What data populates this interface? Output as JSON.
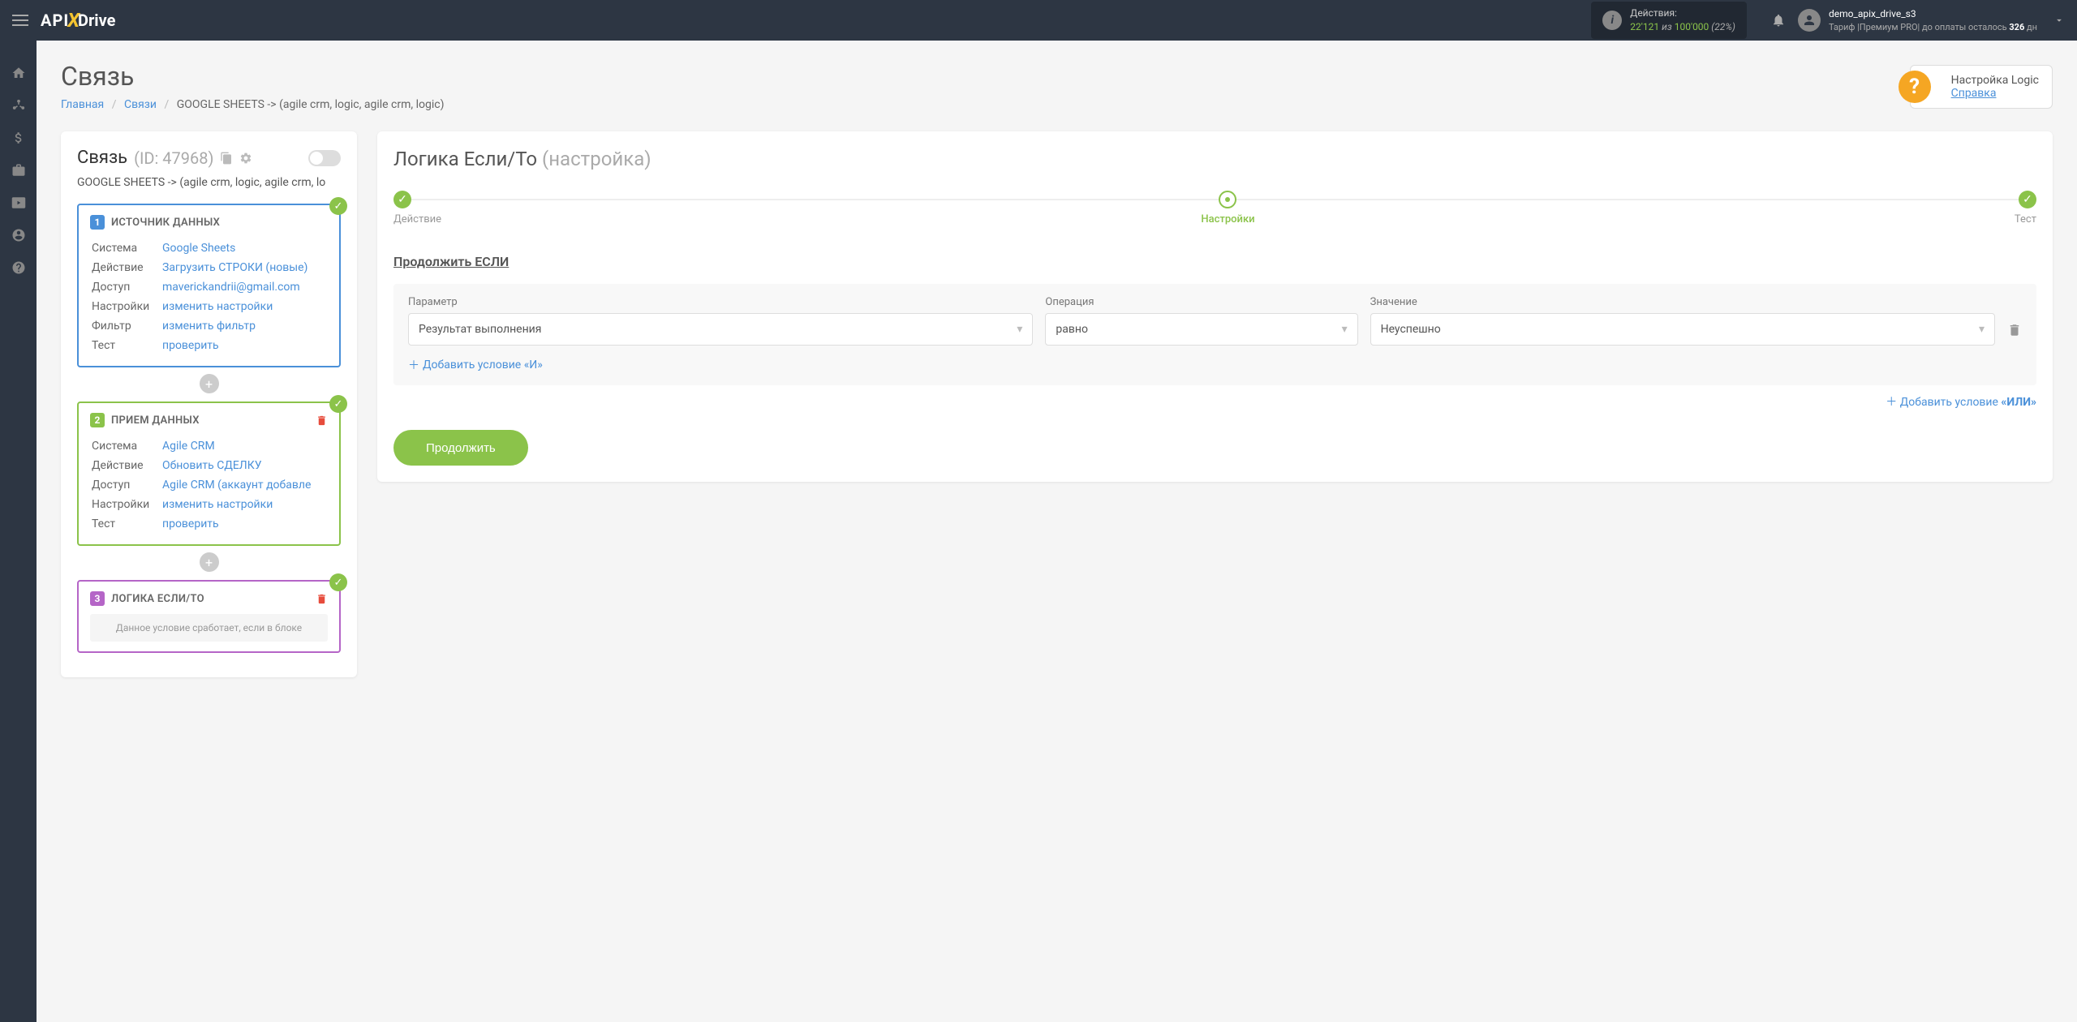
{
  "topbar": {
    "actions_label": "Действия:",
    "actions_used": "22'121",
    "actions_of": "из",
    "actions_total": "100'000",
    "actions_pct": "(22%)",
    "user_name": "demo_apix_drive_s3",
    "tariff_prefix": "Тариф |Премиум PRO| до оплаты осталось ",
    "tariff_days": "326",
    "tariff_suffix": " дн"
  },
  "page": {
    "title": "Связь",
    "breadcrumb": {
      "home": "Главная",
      "links": "Связи",
      "current": "GOOGLE SHEETS -> (agile crm, logic, agile crm, logic)"
    },
    "help": {
      "title": "Настройка Logic",
      "link": "Справка"
    }
  },
  "conn": {
    "title": "Связь",
    "id": "(ID: 47968)",
    "name": "GOOGLE SHEETS -> (agile crm, logic, agile crm, lo"
  },
  "labels": {
    "system": "Система",
    "action": "Действие",
    "access": "Доступ",
    "settings": "Настройки",
    "filter": "Фильтр",
    "test": "Тест",
    "change_settings": "изменить настройки",
    "change_filter": "изменить фильтр",
    "check": "проверить"
  },
  "steps": [
    {
      "num": "1",
      "title": "ИСТОЧНИК ДАННЫХ",
      "color": "blue",
      "system": "Google Sheets",
      "action": "Загрузить СТРОКИ (новые)",
      "access": "maverickandrii@gmail.com",
      "has_filter": true,
      "has_delete": false
    },
    {
      "num": "2",
      "title": "ПРИЕМ ДАННЫХ",
      "color": "green",
      "system": "Agile CRM",
      "action": "Обновить СДЕЛКУ",
      "access": "Agile CRM (аккаунт добавле",
      "has_filter": false,
      "has_delete": true
    },
    {
      "num": "3",
      "title": "ЛОГИКА ЕСЛИ/ТО",
      "color": "purple",
      "note": "Данное условие сработает, если в блоке",
      "has_delete": true
    }
  ],
  "logic": {
    "title": "Логика Если/То",
    "subtitle": "(настройка)",
    "stepper": {
      "s1": "Действие",
      "s2": "Настройки",
      "s3": "Тест"
    },
    "section": "Продолжить ЕСЛИ",
    "fields": {
      "param": "Параметр",
      "operation": "Операция",
      "value": "Значение"
    },
    "values": {
      "param": "Результат выполнения",
      "operation": "равно",
      "value": "Неуспешно"
    },
    "add_and": "Добавить условие «И»",
    "add_or_prefix": "Добавить условие ",
    "add_or_bold": "«ИЛИ»",
    "continue": "Продолжить"
  }
}
